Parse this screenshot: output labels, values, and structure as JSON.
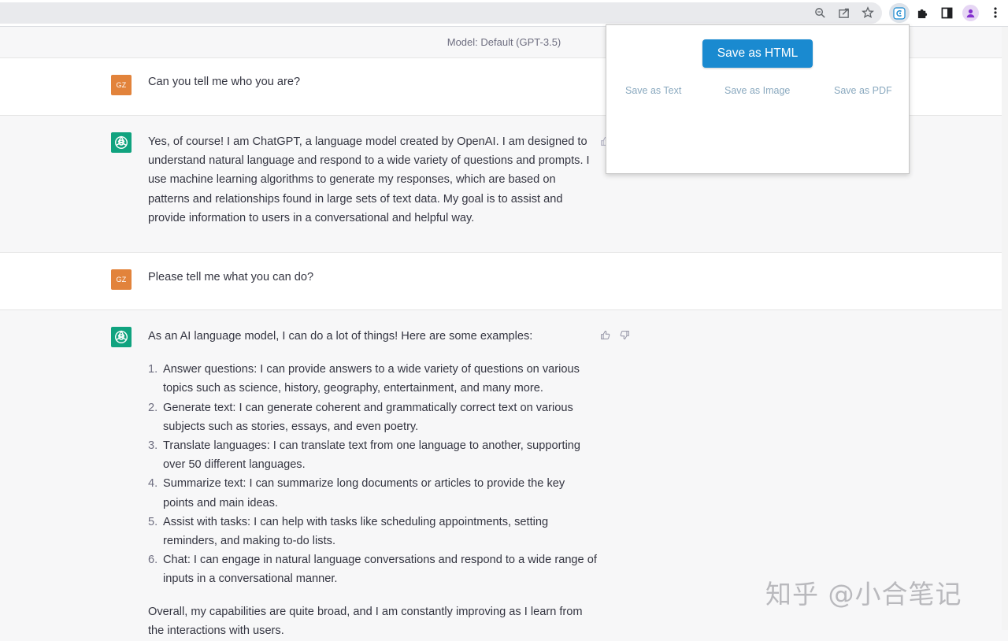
{
  "browser": {
    "toolbar_icons": [
      "zoom-icon",
      "share-icon",
      "bookmark-star-icon",
      "extension-save-icon",
      "puzzle-icon",
      "side-panel-icon",
      "profile-icon",
      "menu-dots-icon"
    ]
  },
  "chat": {
    "model_label": "Model: Default (GPT-3.5)",
    "messages": [
      {
        "role": "user",
        "avatar": "GZ",
        "text": "Can you tell me who you are?"
      },
      {
        "role": "assistant",
        "text": "Yes, of course! I am ChatGPT, a language model created by OpenAI. I am designed to understand natural language and respond to a wide variety of questions and prompts. I use machine learning algorithms to generate my responses, which are based on patterns and relationships found in large sets of text data. My goal is to assist and provide information to users in a conversational and helpful way."
      },
      {
        "role": "user",
        "avatar": "GZ",
        "text": "Please tell me what you can do?"
      },
      {
        "role": "assistant",
        "intro": "As an AI language model, I can do a lot of things! Here are some examples:",
        "items": [
          {
            "num": "1.",
            "text": "Answer questions: I can provide answers to a wide variety of questions on various topics such as science, history, geography, entertainment, and many more."
          },
          {
            "num": "2.",
            "text": "Generate text: I can generate coherent and grammatically correct text on various subjects such as stories, essays, and even poetry."
          },
          {
            "num": "3.",
            "text": "Translate languages: I can translate text from one language to another, supporting over 50 different languages."
          },
          {
            "num": "4.",
            "text": "Summarize text: I can summarize long documents or articles to provide the key points and main ideas."
          },
          {
            "num": "5.",
            "text": "Assist with tasks: I can help with tasks like scheduling appointments, setting reminders, and making to-do lists."
          },
          {
            "num": "6.",
            "text": "Chat: I can engage in natural language conversations and respond to a wide range of inputs in a conversational manner."
          }
        ],
        "outro": "Overall, my capabilities are quite broad, and I am constantly improving as I learn from the interactions with users."
      }
    ]
  },
  "popup": {
    "save_html": "Save as HTML",
    "save_text": "Save as Text",
    "save_image": "Save as Image",
    "save_pdf": "Save as PDF",
    "button_color": "#1a8ad0"
  },
  "watermark": "知乎 @小合笔记"
}
